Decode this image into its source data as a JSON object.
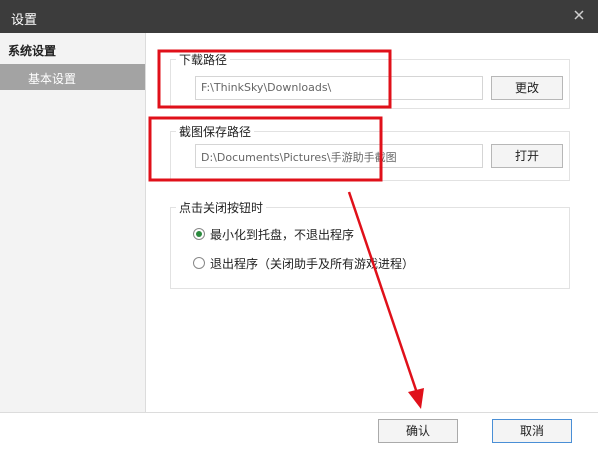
{
  "window": {
    "title": "设置",
    "close_icon": "close-icon"
  },
  "sidebar": {
    "group_label": "系统设置",
    "items": [
      {
        "label": "基本设置",
        "selected": true
      }
    ]
  },
  "download": {
    "legend": "下载路径",
    "path": "F:\\ThinkSky\\Downloads\\",
    "button_label": "更改"
  },
  "screenshot": {
    "legend": "截图保存路径",
    "path": "D:\\Documents\\Pictures\\手游助手截图",
    "button_label": "打开"
  },
  "close_behavior": {
    "legend": "点击关闭按钮时",
    "options": [
      {
        "label": "最小化到托盘，不退出程序",
        "checked": true
      },
      {
        "label": "退出程序（关闭助手及所有游戏进程）",
        "checked": false
      }
    ]
  },
  "footer": {
    "ok_label": "确认",
    "cancel_label": "取消"
  },
  "colors": {
    "titlebar": "#3c3c3c",
    "annotation": "#e0101a",
    "radio_checked": "#2b8a3e",
    "sidebar_selected": "#a3a3a3"
  }
}
